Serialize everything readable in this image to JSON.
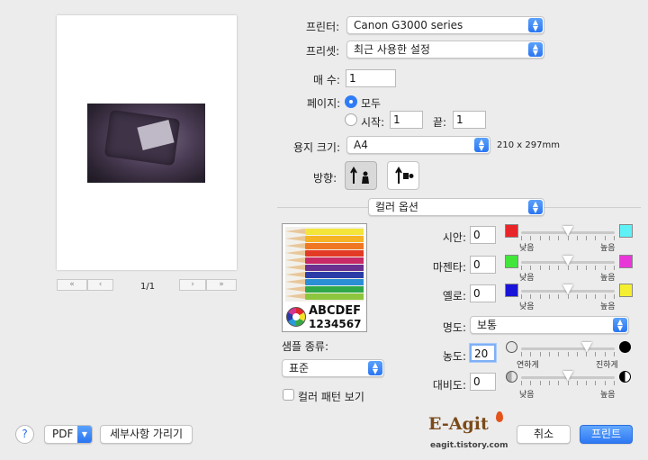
{
  "printer": {
    "label": "프린터:",
    "value": "Canon G3000 series"
  },
  "preset": {
    "label": "프리셋:",
    "value": "최근 사용한 설정"
  },
  "copies": {
    "label": "매 수:",
    "value": "1"
  },
  "pages": {
    "label": "페이지:",
    "all_label": "모두",
    "from_label": "시작:",
    "from_value": "1",
    "to_label": "끝:",
    "to_value": "1"
  },
  "paper": {
    "label": "용지 크기:",
    "value": "A4",
    "dims": "210 x 297mm"
  },
  "orientation": {
    "label": "방향:"
  },
  "section": {
    "value": "컬러 옵션"
  },
  "preview": {
    "page_counter": "1/1"
  },
  "sample": {
    "letters": "ABCDEF",
    "digits": "1234567",
    "kind_label": "샘플 종류:",
    "kind_value": "표준",
    "pattern_label": "컬러 패턴 보기"
  },
  "cyan": {
    "label": "시안:",
    "value": "0",
    "low": "낮음",
    "high": "높음",
    "level": 0.5,
    "low_color": "#e8262a",
    "high_color": "#5ef2f7"
  },
  "magenta": {
    "label": "마젠타:",
    "value": "0",
    "low": "낮음",
    "high": "높음",
    "level": 0.5,
    "low_color": "#42e63b",
    "high_color": "#e936d9"
  },
  "yellow": {
    "label": "옐로:",
    "value": "0",
    "low": "낮음",
    "high": "높음",
    "level": 0.5,
    "low_color": "#1a14d8",
    "high_color": "#f4f031"
  },
  "brightness": {
    "label": "명도:",
    "value": "보통"
  },
  "density": {
    "label": "농도:",
    "value": "20",
    "low": "연하게",
    "high": "진하게",
    "level": 0.7
  },
  "contrast": {
    "label": "대비도:",
    "value": "0",
    "low": "낮음",
    "high": "높음",
    "level": 0.5
  },
  "footer": {
    "help": "?",
    "pdf": "PDF",
    "details": "세부사항 가리기",
    "logo": "E-Agit",
    "logo_sub": "eagit.tistory.com",
    "cancel": "취소",
    "print": "프린트"
  }
}
